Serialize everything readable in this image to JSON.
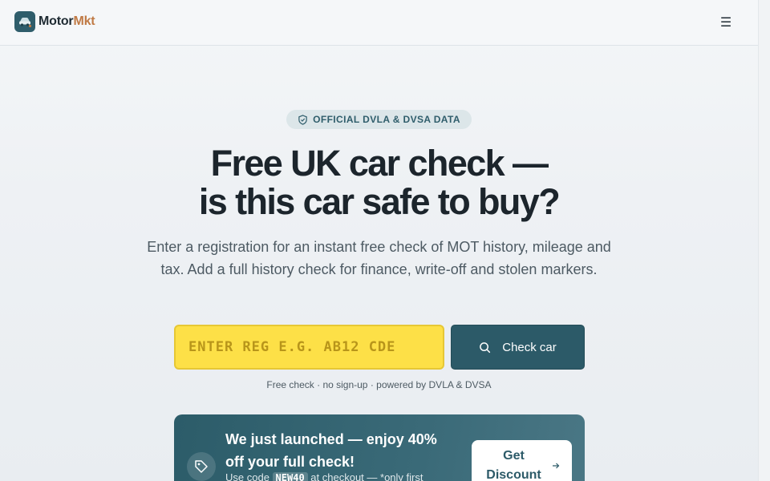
{
  "brand": {
    "name_part1": "Motor",
    "name_part2": "Mkt",
    "primary_color": "#2c5a68",
    "accent_color": "#c07a45"
  },
  "header": {
    "menu_icon": "☰"
  },
  "hero": {
    "badge": "OFFICIAL DVLA & DVSA DATA",
    "title_line1": "Free UK car check —",
    "title_line2": "is this car safe to buy?",
    "subtitle": "Enter a registration for an instant free check of MOT history, mileage and tax. Add a full history check for finance, write-off and stolen markers."
  },
  "search": {
    "placeholder": "ENTER REG E.G. AB12 CDE",
    "value": "",
    "button_label": "Check car",
    "input_color": "#fde047"
  },
  "note": "Free check · no sign-up · powered by DVLA & DVSA",
  "promo": {
    "title": "We just launched — enjoy 40% off your full check!",
    "sub_before": "Use code",
    "code": "NEW40",
    "sub_after": "at checkout — *only first",
    "button_label": "Get Discount"
  }
}
